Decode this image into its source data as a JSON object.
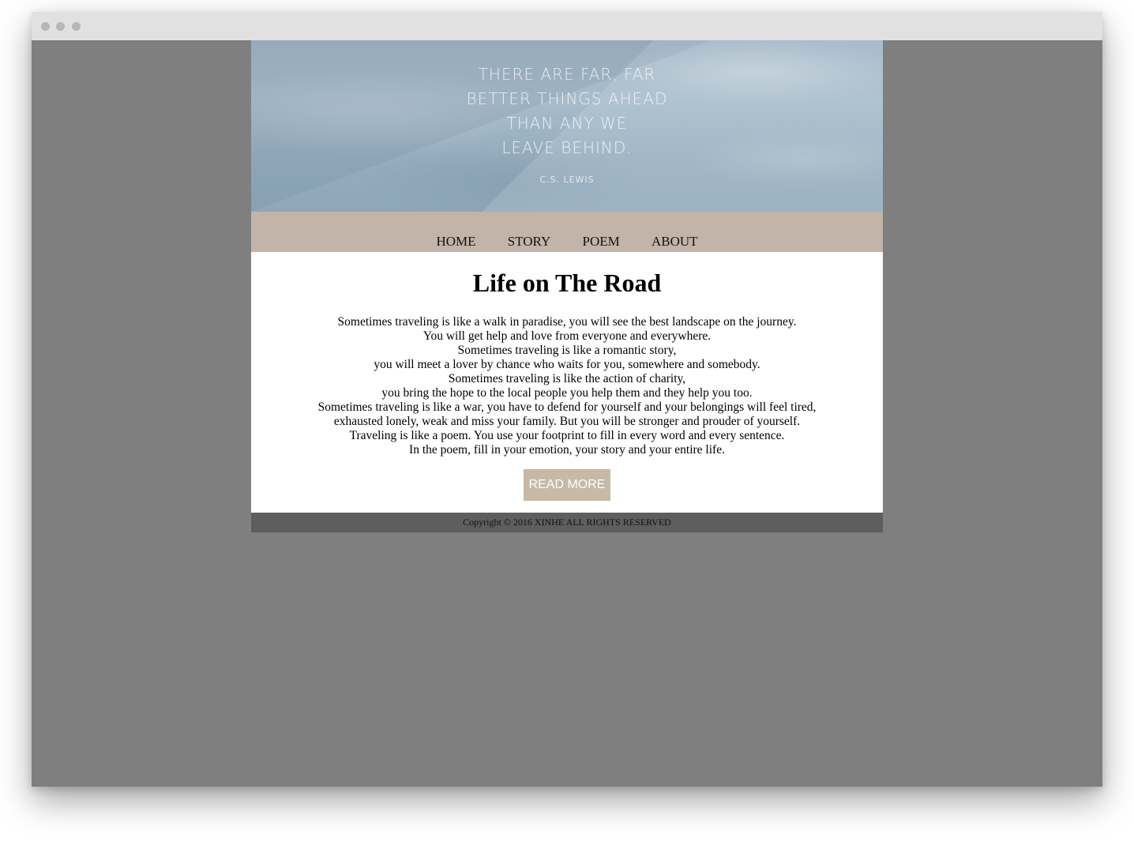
{
  "hero": {
    "quote_lines": [
      "THERE ARE FAR, FAR",
      "BETTER THINGS AHEAD",
      "THAN ANY WE",
      "LEAVE BEHIND."
    ],
    "author": "C.S. LEWIS"
  },
  "nav": {
    "items": [
      "HOME",
      "STORY",
      "POEM",
      "ABOUT"
    ]
  },
  "main": {
    "title": "Life on The Road",
    "poem_lines": [
      "Sometimes traveling is like a walk in paradise, you will see the best landscape on the journey.",
      "You will get help and love from everyone and everywhere.",
      "Sometimes traveling is like a romantic story,",
      "you will meet a lover by chance who waits for you, somewhere and somebody.",
      "Sometimes traveling is like the action of charity,",
      "you bring the hope to the local people you help them and they help you too.",
      "Sometimes traveling is like a war, you have to defend for yourself and your belongings will feel tired,",
      "exhausted lonely, weak and miss your family. But you will be stronger and prouder of yourself.",
      "Traveling is like a poem. You use your footprint to fill in every word and every sentence.",
      "In the poem, fill in your emotion, your story and your entire life."
    ],
    "read_more_label": "READ MORE"
  },
  "footer": {
    "copyright": "Copyright © 2016 XINHE ALL RIGHTS RESERVED"
  },
  "colors": {
    "page_background": "#7f7f7f",
    "nav_background": "#c2b4a8",
    "button_background": "#c6b9a6",
    "footer_background": "#5e5e5e"
  }
}
